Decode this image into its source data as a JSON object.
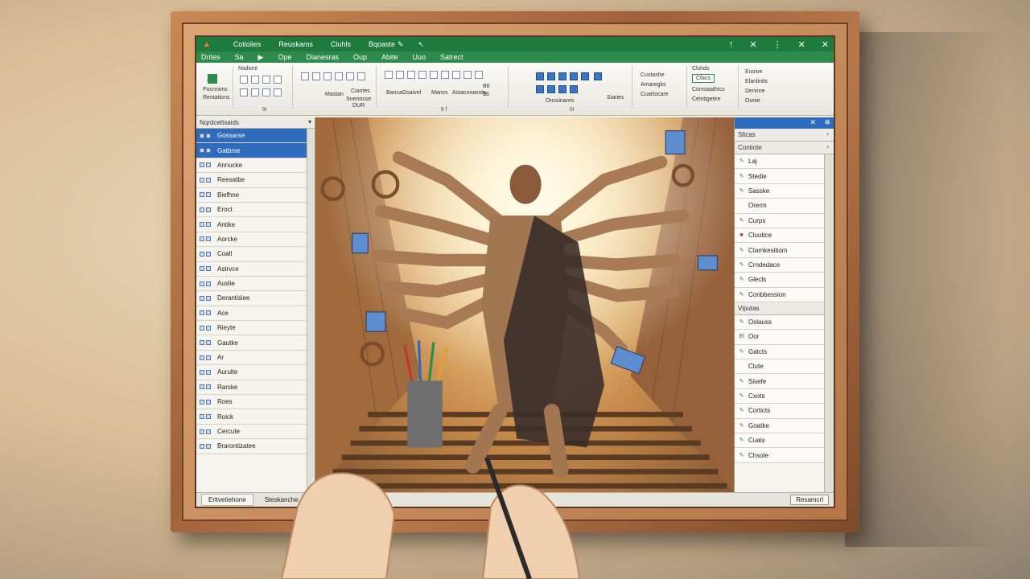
{
  "titlebar": {
    "tabs": [
      "Cotiolies",
      "Reuskams",
      "Cluhls",
      "Bqoaste"
    ],
    "window_controls": [
      "↑",
      "✕",
      "⋮",
      "✕",
      "✕"
    ]
  },
  "tabbar": {
    "items": [
      "Drites",
      "Sa",
      "▶",
      "Ope",
      "Dianesras",
      "Oup",
      "Abite",
      "Uuo",
      "Satrect"
    ]
  },
  "ribbon": {
    "group1": {
      "line1": "Pocnnims",
      "line2": "Rentations"
    },
    "group2": {
      "title": "Nsdiore",
      "label": "9t"
    },
    "group3": {
      "a": "Mastan",
      "b": "Ciantes",
      "c": "Snenosse",
      "d": "DUR"
    },
    "group4": {
      "a": "BancaGsaivel",
      "b": "Mancs",
      "c": "Astacnoassts",
      "d": "B6",
      "e": "$6",
      "label": "9 f"
    },
    "group5": {
      "a": "Onssinares",
      "b": "Siaries",
      "label": "0t"
    },
    "group6": {
      "a": "Custashe",
      "b": "Amaregks",
      "c": "Cuartocare"
    },
    "group7": {
      "title": "Clshds",
      "badge": "Cfacs",
      "a": "Comsaathics",
      "b": "Ceintigetire"
    },
    "group8": {
      "a": "Euoive",
      "b": "Elanlinits",
      "c": "Deninre",
      "d": "Ounie"
    }
  },
  "leftpane": {
    "header": "Nqrdcettsaids",
    "items": [
      "Gossarse",
      "Gatbrse",
      "Annucke",
      "Reesatbe",
      "Biefhne",
      "Eroct",
      "Antike",
      "Aorcke",
      "Coall",
      "Astrvce",
      "Auslie",
      "Derantislee",
      "Ace",
      "Rieyte",
      "Gautke",
      "Ar",
      "Aurulte",
      "Rarske",
      "Roes",
      "Roick",
      "Cercute",
      "Brarontizatee"
    ]
  },
  "rightpane": {
    "head1": "Sltcas",
    "head2": "Contiote",
    "group1": [
      {
        "icon": "✎",
        "label": "Laj"
      },
      {
        "icon": "✎",
        "label": "Stedie"
      },
      {
        "icon": "✎",
        "label": "Sasske"
      },
      {
        "icon": "",
        "label": "Orerm"
      }
    ],
    "group2": [
      {
        "icon": "✎",
        "label": "Curps"
      },
      {
        "icon": "■",
        "label": "Cluutice"
      },
      {
        "icon": "✎",
        "label": "Ctamkesitiom"
      },
      {
        "icon": "✎",
        "label": "Crndedace"
      },
      {
        "icon": "✎",
        "label": "Glecls"
      },
      {
        "icon": "✎",
        "label": "Conbbession"
      }
    ],
    "head3": "Viputas",
    "group3": [
      {
        "icon": "✎",
        "label": "Oslauss"
      },
      {
        "icon": "Bf",
        "label": "Oor"
      },
      {
        "icon": "✎",
        "label": "Gatcts"
      },
      {
        "icon": "",
        "label": "Clute"
      },
      {
        "icon": "✎",
        "label": "Sisefe"
      },
      {
        "icon": "✎",
        "label": "Cxots"
      },
      {
        "icon": "✎",
        "label": "Corticts"
      },
      {
        "icon": "✎",
        "label": "Goatke"
      },
      {
        "icon": "✎",
        "label": "Cuais"
      },
      {
        "icon": "✎",
        "label": "Chsole"
      }
    ]
  },
  "statusbar": {
    "tab1": "Erltvetiehone",
    "tab2": "Steskanche",
    "right": "Resamcrl"
  },
  "colors": {
    "titlebar": "#1e7b3d",
    "selection": "#2f6bbd",
    "frame": "#a0613a"
  }
}
